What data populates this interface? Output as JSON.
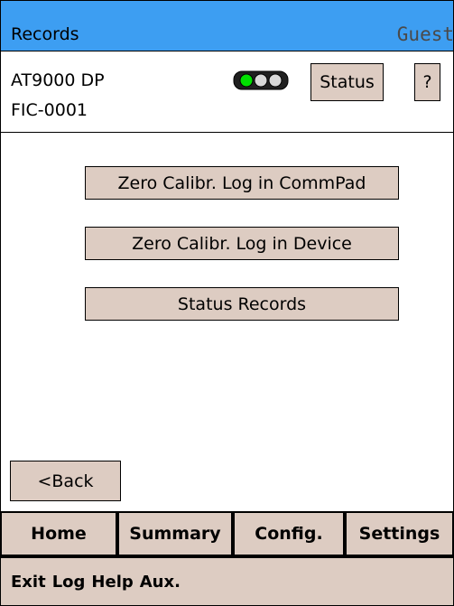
{
  "header": {
    "title": "Records",
    "user": "Guest"
  },
  "device": {
    "model": "AT9000 DP",
    "tag": "FIC-0001",
    "status_button": "Status",
    "help_button": "?",
    "traffic_light": {
      "lights": [
        "#00e000",
        "#d8d8d8",
        "#d8d8d8"
      ]
    }
  },
  "main": {
    "buttons": [
      "Zero Calibr. Log in CommPad",
      "Zero Calibr. Log in Device",
      "Status Records"
    ],
    "back_button": "<Back"
  },
  "tabs": [
    "Home",
    "Summary",
    "Config.",
    "Settings"
  ],
  "menu": [
    "Exit",
    "Log",
    "Help",
    "Aux."
  ],
  "colors": {
    "titlebar": "#3d9ef2",
    "button_bg": "#ddccc2"
  }
}
